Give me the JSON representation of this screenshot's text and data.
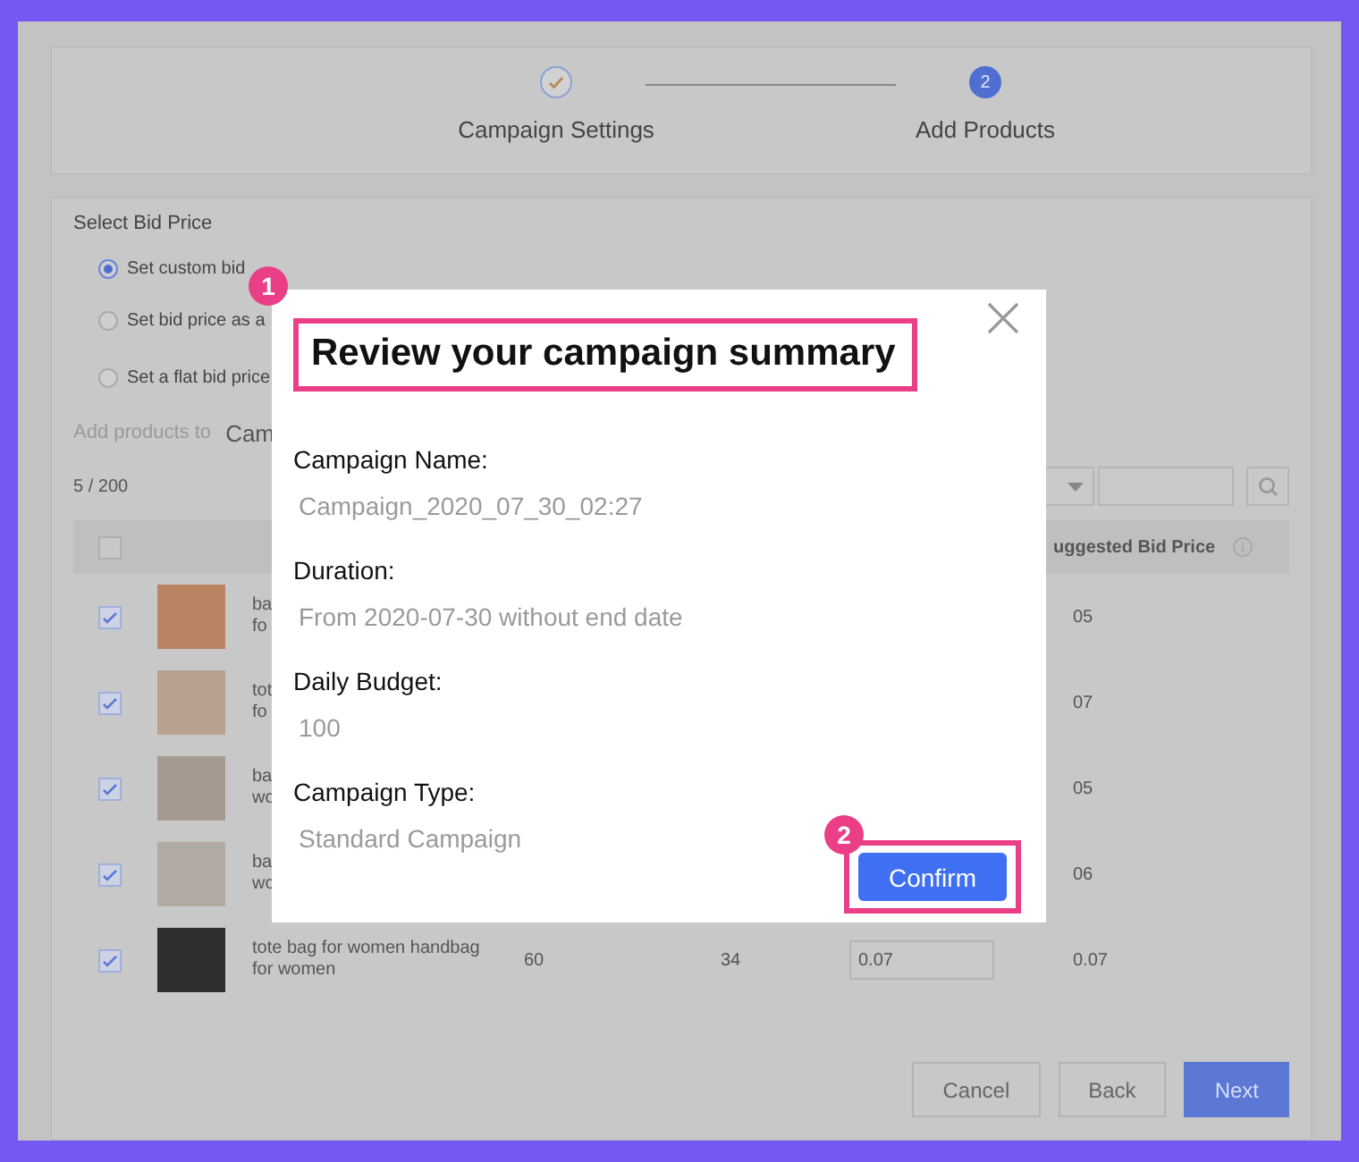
{
  "steps": [
    {
      "label": "Campaign Settings",
      "done": true
    },
    {
      "label": "Add Products",
      "done": false,
      "number": "2"
    }
  ],
  "bid_price": {
    "title": "Select Bid Price",
    "options": [
      {
        "label": "Set custom bid",
        "selected": true
      },
      {
        "label": "Set bid price as a",
        "selected": false
      },
      {
        "label": "Set a flat bid price",
        "selected": false
      }
    ]
  },
  "add_products": {
    "label": "Add products to",
    "value": "Cam"
  },
  "count": "5 / 200",
  "table": {
    "header": {
      "checked": false,
      "column_7": "uggested Bid Price"
    },
    "rows": [
      {
        "checked": true,
        "color": "#b88462",
        "name": "ba\nfo",
        "column_7": "05"
      },
      {
        "checked": true,
        "color": "#b9a18f",
        "name": "tot\nfo",
        "column_7": "07"
      },
      {
        "checked": true,
        "color": "#a59a8f",
        "name": "ba\nwo",
        "column_7": "05"
      },
      {
        "checked": true,
        "color": "#b2aba3",
        "name": "ba\nwo",
        "column_7": "06"
      },
      {
        "checked": true,
        "color": "#2e2e2e",
        "name": "tote bag for women handbag\nfor women",
        "column_4": "60",
        "column_5": "34",
        "bid": "0.07",
        "column_7": "0.07"
      }
    ]
  },
  "buttons": [
    {
      "label": "Cancel",
      "kind": "secondary"
    },
    {
      "label": "Back",
      "kind": "secondary"
    },
    {
      "label": "Next",
      "kind": "primary"
    }
  ],
  "modal": {
    "title": "Review your campaign summary",
    "fields": [
      {
        "label": "Campaign Name:",
        "value": "Campaign_2020_07_30_02:27"
      },
      {
        "label": "Duration:",
        "value": "From 2020-07-30 without end date"
      },
      {
        "label": "Daily Budget:",
        "value": "100"
      },
      {
        "label": "Campaign Type:",
        "value": "Standard Campaign"
      }
    ],
    "confirm": "Confirm",
    "annotations": [
      "1",
      "2"
    ]
  }
}
